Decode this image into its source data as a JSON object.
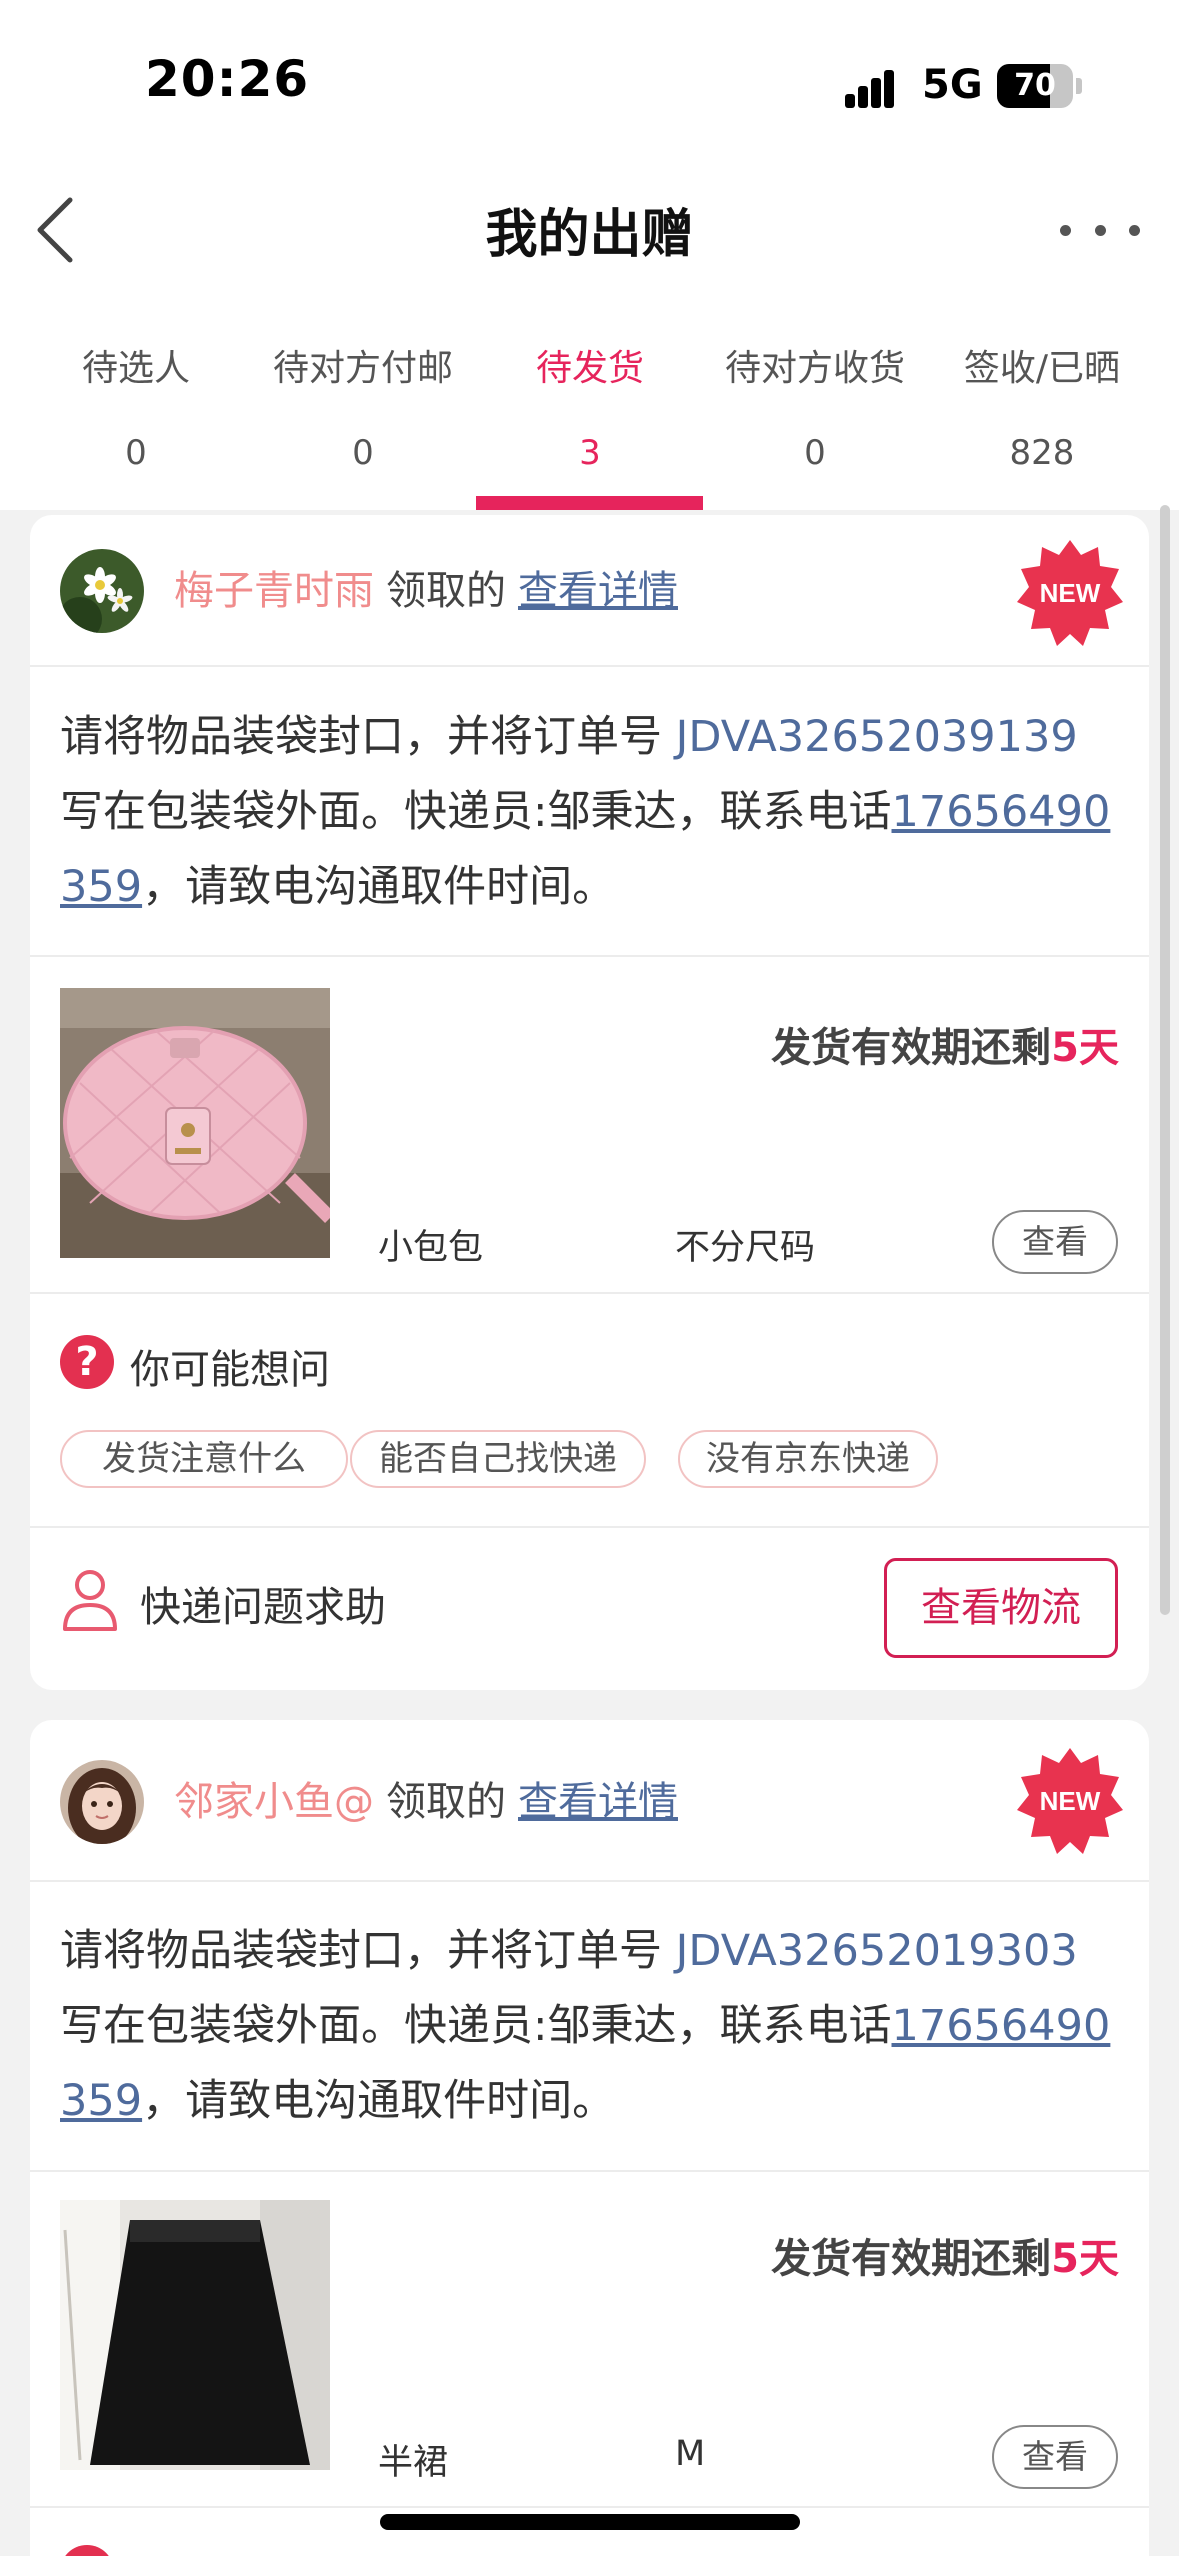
{
  "status_bar": {
    "time": "20:26",
    "network": "5G",
    "battery": "70",
    "battery_level": 0.7
  },
  "nav": {
    "title": "我的出赠",
    "back_icon": "chevron-left-icon",
    "more_icon": "ellipsis-icon"
  },
  "tabs": [
    {
      "label": "待选人",
      "count": "0",
      "active": false
    },
    {
      "label": "待对方付邮",
      "count": "0",
      "active": false
    },
    {
      "label": "待发货",
      "count": "3",
      "active": true
    },
    {
      "label": "待对方收货",
      "count": "0",
      "active": false
    },
    {
      "label": "签收/已晒",
      "count": "828",
      "active": false
    }
  ],
  "colors": {
    "accent": "#e6245c",
    "link": "#4f6b9c",
    "claimer": "#f08c8c",
    "chip_border": "#f2c3c3"
  },
  "orders": [
    {
      "claimer": "梅子青时雨",
      "claimed_text": "领取的",
      "detail_link": "查看详情",
      "badge": "NEW",
      "instr_pre": "请将物品装袋封口，并将订单号 ",
      "order_no": "JDVA32652039139",
      "instr_mid": " 写在包装袋外面。快递员:邹秉达，联系电话",
      "phone": "17656490359",
      "instr_post": "，请致电沟通取件时间。",
      "deadline_pre": "发货有效期还剩",
      "deadline_days": "5天",
      "item_name": "小包包",
      "item_size": "不分尺码",
      "view_label": "查看",
      "faq_title": "你可能想问",
      "faq_chips": [
        "发货注意什么",
        "能否自己找快递",
        "没有京东快递"
      ],
      "help_label": "快递问题求助",
      "logistics_label": "查看物流"
    },
    {
      "claimer": "邻家小鱼@",
      "claimed_text": "领取的",
      "detail_link": "查看详情",
      "badge": "NEW",
      "instr_pre": "请将物品装袋封口，并将订单号 ",
      "order_no": "JDVA32652019303",
      "instr_mid": " 写在包装袋外面。快递员:邹秉达，联系电话",
      "phone": "17656490359",
      "instr_post": "，请致电沟通取件时间。",
      "deadline_pre": "发货有效期还剩",
      "deadline_days": "5天",
      "item_name": "半裙",
      "item_size": "M",
      "view_label": "查看"
    }
  ]
}
